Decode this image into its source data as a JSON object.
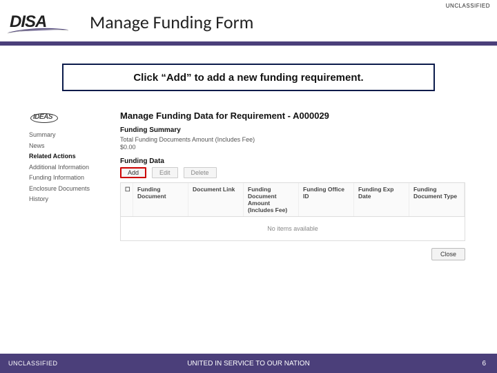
{
  "classification": "UNCLASSIFIED",
  "logo_text": "DISA",
  "slide_title": "Manage Funding Form",
  "instruction": "Click “Add” to add a new funding requirement.",
  "ideas_logo": "IDEAS",
  "side_nav": {
    "items": [
      "Summary",
      "News",
      "Related Actions",
      "Additional Information",
      "Funding Information",
      "Enclosure Documents",
      "History"
    ],
    "active_index": 2
  },
  "main": {
    "heading": "Manage Funding Data for Requirement - A000029",
    "funding_summary_label": "Funding Summary",
    "total_label": "Total Funding Documents Amount (Includes Fee)",
    "total_value": "$0.00",
    "funding_data_label": "Funding Data",
    "buttons": {
      "add": "Add",
      "edit": "Edit",
      "delete": "Delete"
    },
    "table": {
      "columns": [
        "Funding Document",
        "Document Link",
        "Funding Document Amount (Includes Fee)",
        "Funding Office ID",
        "Funding Exp Date",
        "Funding Document Type"
      ],
      "empty_text": "No items available"
    },
    "close_label": "Close"
  },
  "footer": {
    "left": "UNCLASSIFIED",
    "center": "UNITED IN SERVICE TO OUR NATION",
    "page": "6"
  }
}
